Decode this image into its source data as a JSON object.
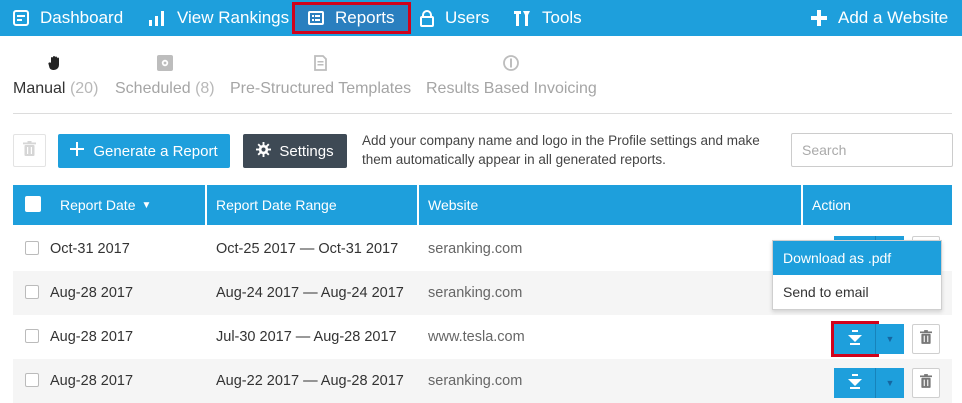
{
  "nav": {
    "items": [
      {
        "label": "Dashboard",
        "icon": "dashboard-icon"
      },
      {
        "label": "View Rankings",
        "icon": "bar-chart-icon"
      },
      {
        "label": "Reports",
        "icon": "list-icon"
      },
      {
        "label": "Users",
        "icon": "lock-icon"
      },
      {
        "label": "Tools",
        "icon": "tools-icon"
      }
    ],
    "add_website": "Add a Website"
  },
  "subtabs": [
    {
      "label": "Manual",
      "count": "(20)",
      "icon": "hand-icon"
    },
    {
      "label": "Scheduled",
      "count": "(8)",
      "icon": "gear-icon"
    },
    {
      "label": "Pre-Structured Templates",
      "count": "",
      "icon": "document-icon"
    },
    {
      "label": "Results Based Invoicing",
      "count": "",
      "icon": "dollar-icon"
    }
  ],
  "toolbar": {
    "generate_label": "Generate a Report",
    "settings_label": "Settings",
    "hint": "Add your company name and logo in the Profile settings and make them automatically appear in all generated reports.",
    "search_placeholder": "Search"
  },
  "table": {
    "columns": [
      "Report Date",
      "Report Date Range",
      "Website",
      "Action"
    ],
    "sort_indicator": "▼",
    "rows": [
      {
        "date": "Oct-31 2017",
        "range": "Oct-25 2017 — Oct-31 2017",
        "website": "seranking.com"
      },
      {
        "date": "Aug-28 2017",
        "range": "Aug-24 2017 — Aug-24 2017",
        "website": "seranking.com"
      },
      {
        "date": "Aug-28 2017",
        "range": "Jul-30 2017 — Aug-28 2017",
        "website": "www.tesla.com"
      },
      {
        "date": "Aug-28 2017",
        "range": "Aug-22 2017 — Aug-28 2017",
        "website": "seranking.com"
      }
    ]
  },
  "dropdown": {
    "items": [
      "Download as .pdf",
      "Send to email"
    ]
  },
  "colors": {
    "accent": "#1e9fdc",
    "dark_button": "#3e4a55",
    "highlight": "#d0021b"
  }
}
